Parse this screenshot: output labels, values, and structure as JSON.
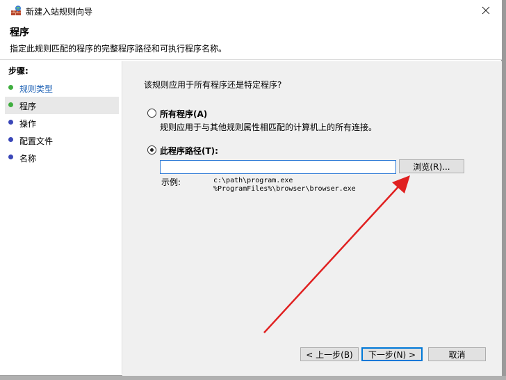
{
  "window": {
    "title": "新建入站规则向导"
  },
  "header": {
    "title": "程序",
    "description": "指定此规则匹配的程序的完整程序路径和可执行程序名称。"
  },
  "sidebar": {
    "heading": "步骤:",
    "items": [
      {
        "label": "规则类型",
        "dot_color": "#3fae3f"
      },
      {
        "label": "程序",
        "dot_color": "#3fae3f"
      },
      {
        "label": "操作",
        "dot_color": "#3a47b8"
      },
      {
        "label": "配置文件",
        "dot_color": "#3a47b8"
      },
      {
        "label": "名称",
        "dot_color": "#3a47b8"
      }
    ]
  },
  "content": {
    "question": "该规则应用于所有程序还是特定程序?",
    "all_programs": {
      "label": "所有程序(A)",
      "description": "规则应用于与其他规则属性相匹配的计算机上的所有连接。"
    },
    "this_program": {
      "label": "此程序路径(T):",
      "value": "",
      "browse_label": "浏览(R)..."
    },
    "example": {
      "label": "示例:",
      "line1": "c:\\path\\program.exe",
      "line2": "%ProgramFiles%\\browser\\browser.exe"
    }
  },
  "buttons": {
    "back": "< 上一步(B)",
    "next": "下一步(N) >",
    "cancel": "取消"
  },
  "colors": {
    "arrow": "#e02020",
    "accent": "#0078d7"
  }
}
